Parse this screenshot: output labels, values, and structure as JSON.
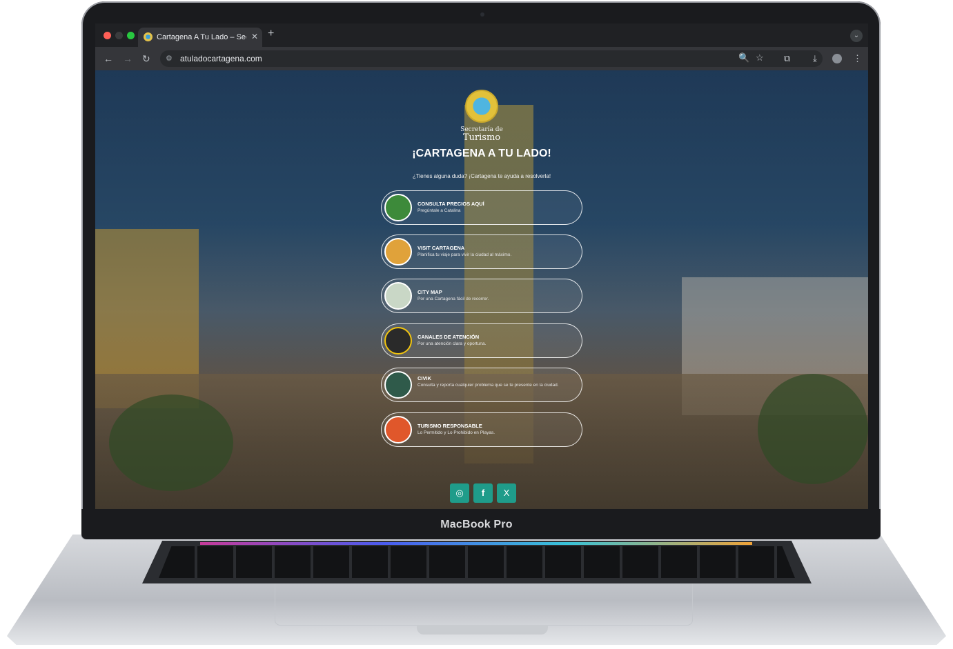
{
  "device": {
    "brand": "MacBook Pro"
  },
  "browser": {
    "tab": {
      "title": "Cartagena A Tu Lado – Secre",
      "close": "✕"
    },
    "new_tab": "+",
    "tab_menu": "⌄",
    "nav": {
      "back": "←",
      "forward": "→",
      "reload": "↻"
    },
    "omnibox": {
      "site_info": "⚙",
      "url": "atuladocartagena.com",
      "zoom": "🔍",
      "star": "☆"
    },
    "toolbar": {
      "extensions": "⧉",
      "download": "⤓",
      "menu": "⋮"
    }
  },
  "page": {
    "logo": {
      "line1": "Secretaría de",
      "line2": "Turismo"
    },
    "title": "¡CARTAGENA A TU LADO!",
    "subtitle": "¿Tienes alguna duda? ¡Cartagena te ayuda a resolverla!",
    "cards": [
      {
        "title": "CONSULTA PRECIOS AQUÍ",
        "subtitle": "Pregúntale a Catalina",
        "icon": "catalina-avatar-icon",
        "color": "#3d8a3a"
      },
      {
        "title": "VISIT CARTAGENA",
        "subtitle": "Planifica tu viaje para vivir la ciudad al máximo.",
        "icon": "visit-cartagena-avatar-icon",
        "color": "#e0a23a"
      },
      {
        "title": "CITY MAP",
        "subtitle": "Por una Cartagena fácil de recorrer.",
        "icon": "city-map-icon",
        "color": "#c9d7c6"
      },
      {
        "title": "CANALES DE ATENCIÓN",
        "subtitle": "Por una atención clara y oportuna.",
        "icon": "buena-esa-cartagena-icon",
        "color": "#2a2a2a"
      },
      {
        "title": "CIVIK",
        "subtitle": "Consulta y reporta cualquier problema que se te presente en la ciudad.",
        "icon": "civik-icon",
        "color": "#2f5a4a"
      },
      {
        "title": "TURISMO RESPONSABLE",
        "subtitle": "Lo Permitido y Lo Prohibido en Playas.",
        "icon": "turismo-responsable-icon",
        "color": "#e0572b"
      }
    ],
    "socials": [
      {
        "name": "instagram-icon",
        "glyph": "◎"
      },
      {
        "name": "facebook-icon",
        "glyph": "f"
      },
      {
        "name": "x-icon",
        "glyph": "X"
      }
    ]
  },
  "colors": {
    "social_bg": "#1f9c8a",
    "chrome_dark": "#202124"
  }
}
